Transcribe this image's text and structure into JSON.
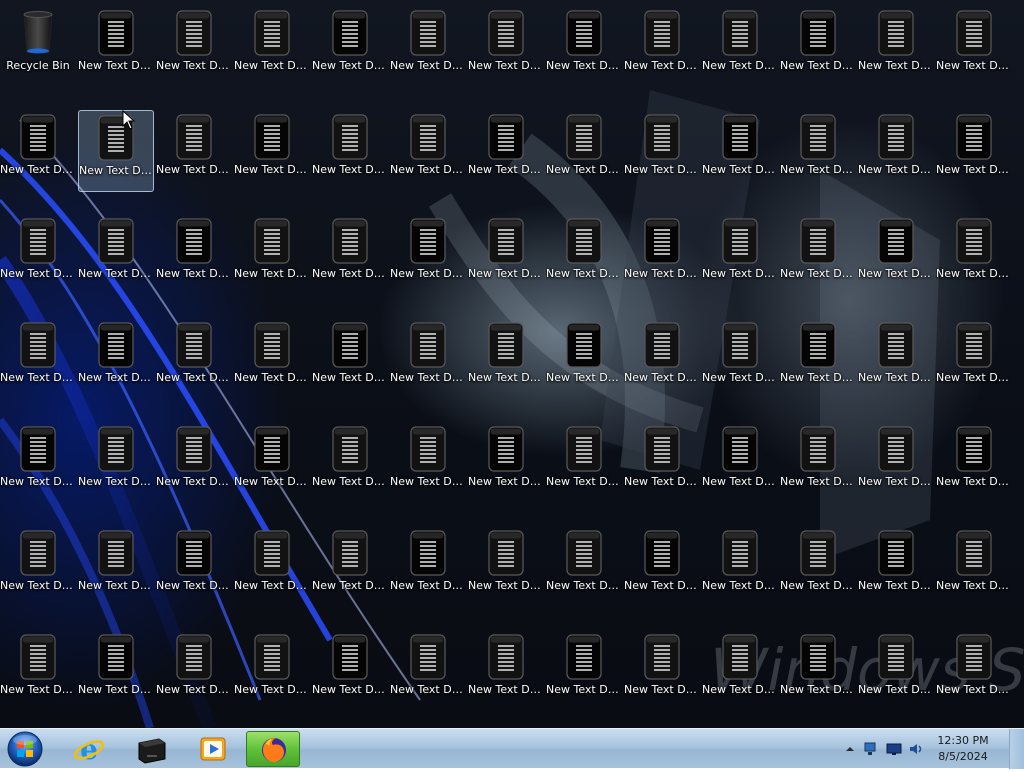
{
  "desktop": {
    "wallpaper_text": "Windows Seven",
    "icons": [
      {
        "label": "Recycle Bin",
        "type": "recycle-bin"
      },
      {
        "label": "New Text Document.txt"
      },
      {
        "label": "New Text Documen..."
      },
      {
        "label": "New Text Document..."
      },
      {
        "label": "New Text Document ..."
      },
      {
        "label": "New Text Document ..."
      },
      {
        "label": "New Text Documen..."
      },
      {
        "label": "New Text Documen..."
      },
      {
        "label": "New Text Documen..."
      },
      {
        "label": "New Text Document ..."
      },
      {
        "label": "New Text Documen..."
      },
      {
        "label": "New Text Documen..."
      },
      {
        "label": "New Text Documen..."
      },
      {
        "label": "New Text Documen..."
      },
      {
        "label": "New Text Documen...",
        "selected": true
      },
      {
        "label": "New Text Document..."
      },
      {
        "label": "New Text Document..."
      },
      {
        "label": "New Text Documen..."
      },
      {
        "label": "New Text Documen..."
      },
      {
        "label": "New Text Document..."
      },
      {
        "label": "New Text Document..."
      },
      {
        "label": "New Text Document..."
      },
      {
        "label": "New Text Document..."
      },
      {
        "label": "New Text Documen..."
      },
      {
        "label": "New Text Documen..."
      },
      {
        "label": "New Text Documen..."
      },
      {
        "label": "New Text Document..."
      },
      {
        "label": "New Text Documen..."
      },
      {
        "label": "New Text Document..."
      },
      {
        "label": "New Text Documen..."
      },
      {
        "label": "New Text Documen..."
      },
      {
        "label": "New Text Documen..."
      },
      {
        "label": "New Text Document..."
      },
      {
        "label": "New Text Documen..."
      },
      {
        "label": "New Text Documen..."
      },
      {
        "label": "New Text Document..."
      },
      {
        "label": "New Text Documen..."
      },
      {
        "label": "New Text Document..."
      },
      {
        "label": "New Text Document..."
      },
      {
        "label": "New Text Documen..."
      },
      {
        "label": "New Text Document ..."
      },
      {
        "label": "New Text Documen..."
      },
      {
        "label": "New Text Documen..."
      },
      {
        "label": "New Text Documen..."
      },
      {
        "label": "New Text Documen..."
      },
      {
        "label": "New Text Documen..."
      },
      {
        "label": "New Text Document ..."
      },
      {
        "label": "New Text Documen..."
      },
      {
        "label": "New Text Documen..."
      },
      {
        "label": "New Text Documen..."
      },
      {
        "label": "New Text Document ..."
      },
      {
        "label": "New Text Documen..."
      },
      {
        "label": "New Text Document..."
      },
      {
        "label": "New Text Document ..."
      },
      {
        "label": "New Text Documen..."
      },
      {
        "label": "New Text Document ..."
      },
      {
        "label": "New Text Documen..."
      },
      {
        "label": "New Text Documen..."
      },
      {
        "label": "New Text Documen..."
      },
      {
        "label": "New Text Document..."
      },
      {
        "label": "New Text Documen..."
      },
      {
        "label": "New Text Documen..."
      },
      {
        "label": "New Text Document ..."
      },
      {
        "label": "New Text Documen..."
      },
      {
        "label": "New Text Documen..."
      },
      {
        "label": "New Text Document..."
      },
      {
        "label": "New Text Documen..."
      },
      {
        "label": "New Text Document..."
      },
      {
        "label": "New Text Document..."
      },
      {
        "label": "New Text Document ..."
      },
      {
        "label": "New Text Documen..."
      },
      {
        "label": "New Text Documen..."
      },
      {
        "label": "New Text Document..."
      },
      {
        "label": "New Text Document ..."
      },
      {
        "label": "New Text Documen..."
      },
      {
        "label": "New Text Document..."
      },
      {
        "label": "New Text Documen..."
      },
      {
        "label": "New Text Document..."
      },
      {
        "label": "New Text Documen..."
      },
      {
        "label": "New Text Document ..."
      },
      {
        "label": "New Text Document ..."
      },
      {
        "label": "New Text Documen..."
      },
      {
        "label": "New Text Documen..."
      },
      {
        "label": "New Text Documen..."
      },
      {
        "label": "New Text Documen..."
      },
      {
        "label": "New Text Documen..."
      },
      {
        "label": "New Text Document..."
      },
      {
        "label": "New Text Document..."
      },
      {
        "label": "New Text Documen..."
      },
      {
        "label": "New Text Documen..."
      },
      {
        "label": "New Text Document..."
      }
    ]
  },
  "taskbar": {
    "start_button": "start-orb-icon",
    "pinned": [
      {
        "name": "internet-explorer",
        "icon": "ie-icon",
        "active": false
      },
      {
        "name": "file-manager",
        "icon": "drive-icon",
        "active": false
      },
      {
        "name": "media-player",
        "icon": "media-player-icon",
        "active": false
      },
      {
        "name": "firefox",
        "icon": "firefox-icon",
        "active": true
      }
    ],
    "tray": {
      "icons": [
        "chevron-up-icon",
        "network-icon",
        "display-icon",
        "volume-icon"
      ],
      "time": "12:30 PM",
      "date": "8/5/2024"
    }
  }
}
